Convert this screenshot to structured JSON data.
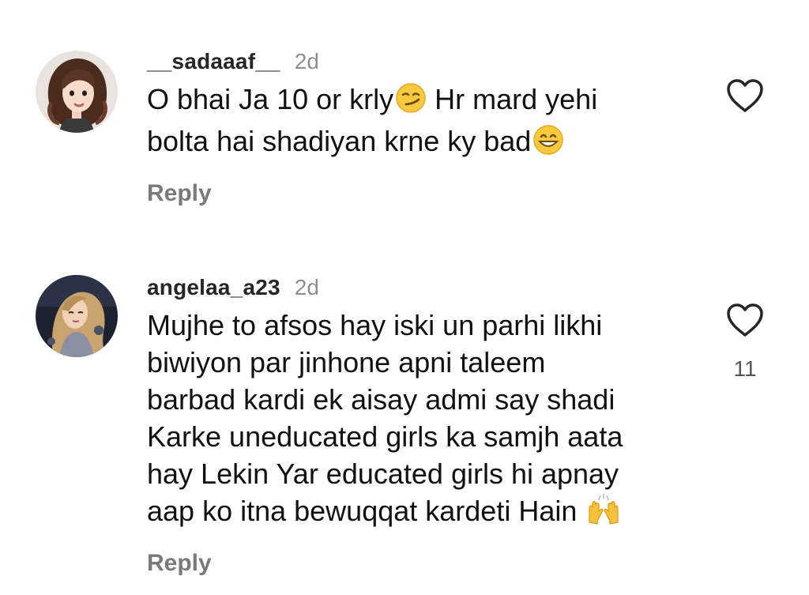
{
  "comments": [
    {
      "username": "__sadaaaf__",
      "timestamp": "2d",
      "text_line1": "O bhai Ja 10 or krly",
      "text_line1_tail": " Hr mard yehi",
      "text_line2": "bolta hai shadiyan krne ky bad",
      "reply_label": "Reply",
      "like_icon": "heart-outline-icon",
      "avatar_icon": "girl-avatar-icon"
    },
    {
      "username": "angelaa_a23",
      "timestamp": "2d",
      "text_lines": [
        "Mujhe to afsos hay iski un parhi likhi",
        "biwiyon par jinhone apni taleem",
        "barbad kardi ek aisay admi say shadi",
        "Karke uneducated girls ka samjh aata",
        "hay Lekin Yar educated girls hi apnay",
        "aap ko itna bewuqqat kardeti Hain "
      ],
      "reply_label": "Reply",
      "like_icon": "heart-outline-icon",
      "like_count": "11",
      "avatar_icon": "princess-avatar-icon"
    }
  ],
  "colors": {
    "username": "#262626",
    "timestamp": "#8e8e8e",
    "reply": "#7a7a7a",
    "text": "#111111"
  }
}
